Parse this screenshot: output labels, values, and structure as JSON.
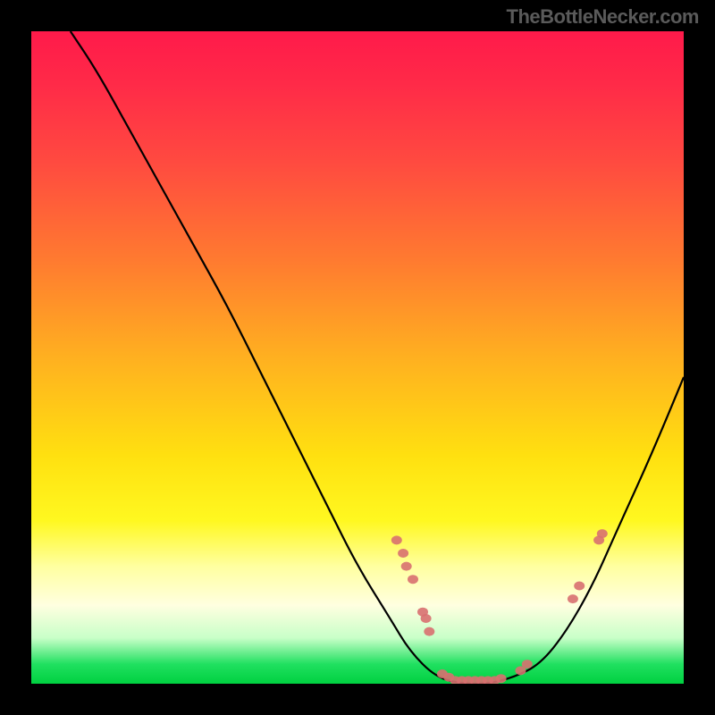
{
  "watermark": "TheBottleNecker.com",
  "chart_data": {
    "type": "line",
    "title": "",
    "xlabel": "",
    "ylabel": "",
    "xlim": [
      0,
      100
    ],
    "ylim": [
      0,
      100
    ],
    "curve": [
      {
        "x": 6,
        "y": 100
      },
      {
        "x": 10,
        "y": 94
      },
      {
        "x": 15,
        "y": 85
      },
      {
        "x": 20,
        "y": 76
      },
      {
        "x": 25,
        "y": 67
      },
      {
        "x": 30,
        "y": 58
      },
      {
        "x": 35,
        "y": 48
      },
      {
        "x": 40,
        "y": 38
      },
      {
        "x": 45,
        "y": 28
      },
      {
        "x": 50,
        "y": 18
      },
      {
        "x": 55,
        "y": 10
      },
      {
        "x": 58,
        "y": 5
      },
      {
        "x": 62,
        "y": 1
      },
      {
        "x": 66,
        "y": 0
      },
      {
        "x": 70,
        "y": 0
      },
      {
        "x": 74,
        "y": 1
      },
      {
        "x": 78,
        "y": 3
      },
      {
        "x": 82,
        "y": 8
      },
      {
        "x": 86,
        "y": 15
      },
      {
        "x": 90,
        "y": 24
      },
      {
        "x": 95,
        "y": 35
      },
      {
        "x": 100,
        "y": 47
      }
    ],
    "markers": [
      {
        "x": 56,
        "y": 22
      },
      {
        "x": 57,
        "y": 20
      },
      {
        "x": 57.5,
        "y": 18
      },
      {
        "x": 58.5,
        "y": 16
      },
      {
        "x": 60,
        "y": 11
      },
      {
        "x": 60.5,
        "y": 10
      },
      {
        "x": 61,
        "y": 8
      },
      {
        "x": 63,
        "y": 1.5
      },
      {
        "x": 64,
        "y": 1
      },
      {
        "x": 65,
        "y": 0.5
      },
      {
        "x": 66,
        "y": 0.5
      },
      {
        "x": 67,
        "y": 0.5
      },
      {
        "x": 68,
        "y": 0.5
      },
      {
        "x": 69,
        "y": 0.5
      },
      {
        "x": 70,
        "y": 0.5
      },
      {
        "x": 71,
        "y": 0.5
      },
      {
        "x": 72,
        "y": 0.8
      },
      {
        "x": 75,
        "y": 2
      },
      {
        "x": 76,
        "y": 3
      },
      {
        "x": 83,
        "y": 13
      },
      {
        "x": 84,
        "y": 15
      },
      {
        "x": 87,
        "y": 22
      },
      {
        "x": 87.5,
        "y": 23
      }
    ]
  }
}
